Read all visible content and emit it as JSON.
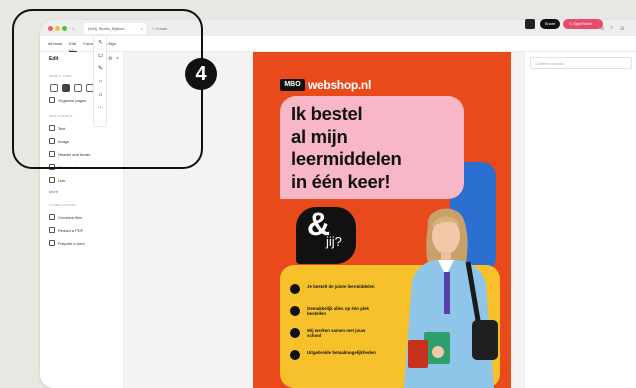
{
  "browser": {
    "tab_title": "(494) Studio_Bijsturi...",
    "tab_close": "×",
    "new_tab": "+ Create"
  },
  "menubar": {
    "items": [
      "All tools",
      "Edit",
      "Convert",
      "E-Sign"
    ],
    "edit_sub": "Edit"
  },
  "sidebar": {
    "title": "Edit",
    "section_pages": "Select page",
    "organize_pages": "Organize pages",
    "section_add": "Add content",
    "add_items": [
      "Text",
      "Image",
      "Header and footer",
      "Watermark",
      "Link"
    ],
    "more_link": "More",
    "section_other": "Other options",
    "other_items": [
      "Combine files",
      "Redact a PDF",
      "Prepare a form"
    ]
  },
  "toolbar": {
    "share_label": "Share",
    "sign_label": "E-Sign/Send"
  },
  "comments": {
    "placeholder": "Comment via tools"
  },
  "poster": {
    "logo_box": "MBO",
    "logo_text": "webshop.nl",
    "headline_lines": [
      "Ik bestel",
      "al mijn",
      "leermiddelen",
      "in één keer!"
    ],
    "amp": "&",
    "jij": "jij?",
    "bullets": [
      "Je bestelt de juiste leermiddelen",
      "Gemakkelijk alles op één plek bestellen",
      "Wij werken samen met jouw school",
      "Uitgebreide betaalmogelijkheden"
    ]
  },
  "annotation": {
    "badge": "4"
  },
  "colors": {
    "poster_bg": "#e84a1c",
    "pink": "#f7b7c6",
    "yellow": "#f6c12b",
    "blue": "#2b6fd1",
    "sign_button": "#e84b6d"
  }
}
